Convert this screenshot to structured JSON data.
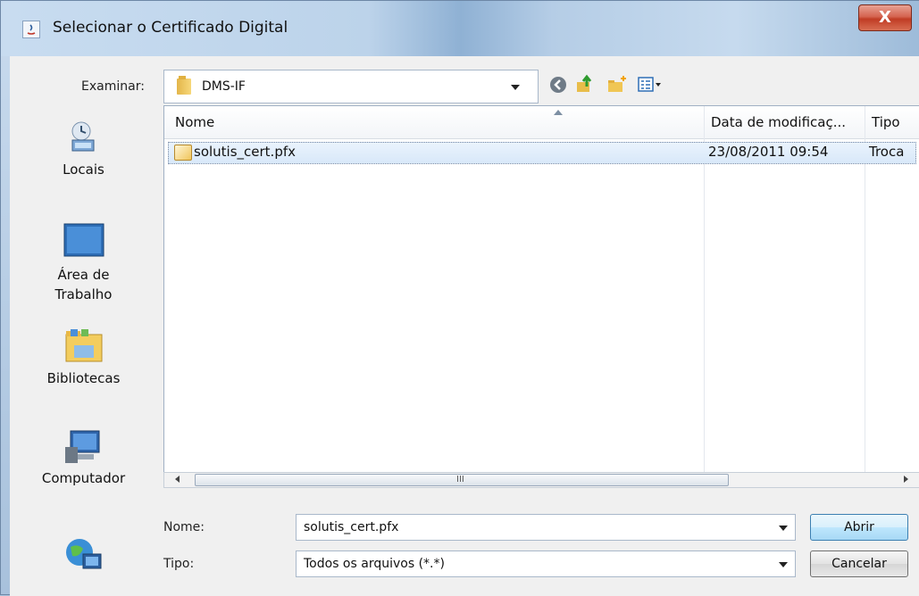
{
  "window": {
    "title": "Selecionar o Certificado Digital"
  },
  "toolbar": {
    "examinar_label": "Examinar:",
    "location": "DMS-IF"
  },
  "places": [
    {
      "label": "Locais"
    },
    {
      "label": "Área de Trabalho"
    },
    {
      "label": "Bibliotecas"
    },
    {
      "label": "Computador"
    }
  ],
  "list": {
    "columns": [
      "Nome",
      "Data de modificaç...",
      "Tipo"
    ],
    "rows": [
      {
        "name": "solutis_cert.pfx",
        "date": "23/08/2011 09:54",
        "type": "Troca"
      }
    ]
  },
  "scroll_grip": "III",
  "form": {
    "nome_label": "Nome:",
    "nome_value": "solutis_cert.pfx",
    "tipo_label": "Tipo:",
    "tipo_value": "Todos os arquivos (*.*)"
  },
  "buttons": {
    "open": "Abrir",
    "cancel": "Cancelar",
    "close": "X"
  },
  "icons": [
    "java-icon",
    "folder-icon",
    "back-icon",
    "up-folder-icon",
    "new-folder-icon",
    "view-menu-icon",
    "recent-places-icon",
    "desktop-icon",
    "libraries-icon",
    "computer-icon",
    "network-icon",
    "certificate-file-icon"
  ]
}
